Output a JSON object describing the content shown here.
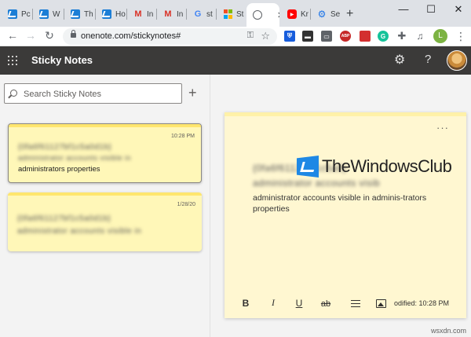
{
  "browser": {
    "tabs": [
      {
        "label": "Pc",
        "icon": "twc-icon"
      },
      {
        "label": "W",
        "icon": "twc-icon"
      },
      {
        "label": "Th",
        "icon": "twc-icon"
      },
      {
        "label": "Ho",
        "icon": "twc-icon"
      },
      {
        "label": "In",
        "icon": "gmail-icon"
      },
      {
        "label": "In",
        "icon": "gmail-icon"
      },
      {
        "label": "st",
        "icon": "google-icon"
      },
      {
        "label": "St",
        "icon": "microsoft-icon"
      },
      {
        "label": "",
        "icon": "globe-icon",
        "active": true
      },
      {
        "label": "Kr",
        "icon": "youtube-icon"
      },
      {
        "label": "Se",
        "icon": "settings-gear-icon"
      }
    ],
    "new_tab_glyph": "+",
    "url": "onenote.com/stickynotes#",
    "profile_initial": "L",
    "extensions": [
      "bitwarden",
      "dark",
      "abp",
      "red-ext",
      "grammarly",
      "puzzle",
      "music"
    ],
    "extension_abp_label": "ABP"
  },
  "app": {
    "title": "Sticky Notes",
    "search_placeholder": "Search Sticky Notes"
  },
  "notes": [
    {
      "date": "10:28 PM",
      "line1": "{0fa6f61127bf1c5a0d1b}",
      "line2": "administrator accounts visible in",
      "line3": "administrators properties",
      "selected": true
    },
    {
      "date": "1/28/20",
      "line1": "{0fa6f61127bf1c5a0d1b}",
      "line2": "administrator accounts visible in",
      "line3": "",
      "selected": false
    }
  ],
  "editor": {
    "more_glyph": "···",
    "line1": "{0fa6f61127bf1c5a0}",
    "line2": "administrator accounts visib",
    "body": "administrator accounts visible in adminis-trators properties",
    "modified": "odified: 10:28 PM",
    "format_bold": "B",
    "format_italic": "I",
    "format_underline": "U",
    "format_strike": "ab"
  },
  "watermark": {
    "brand": "TheWindowsClub",
    "site": "wsxdn.com"
  }
}
